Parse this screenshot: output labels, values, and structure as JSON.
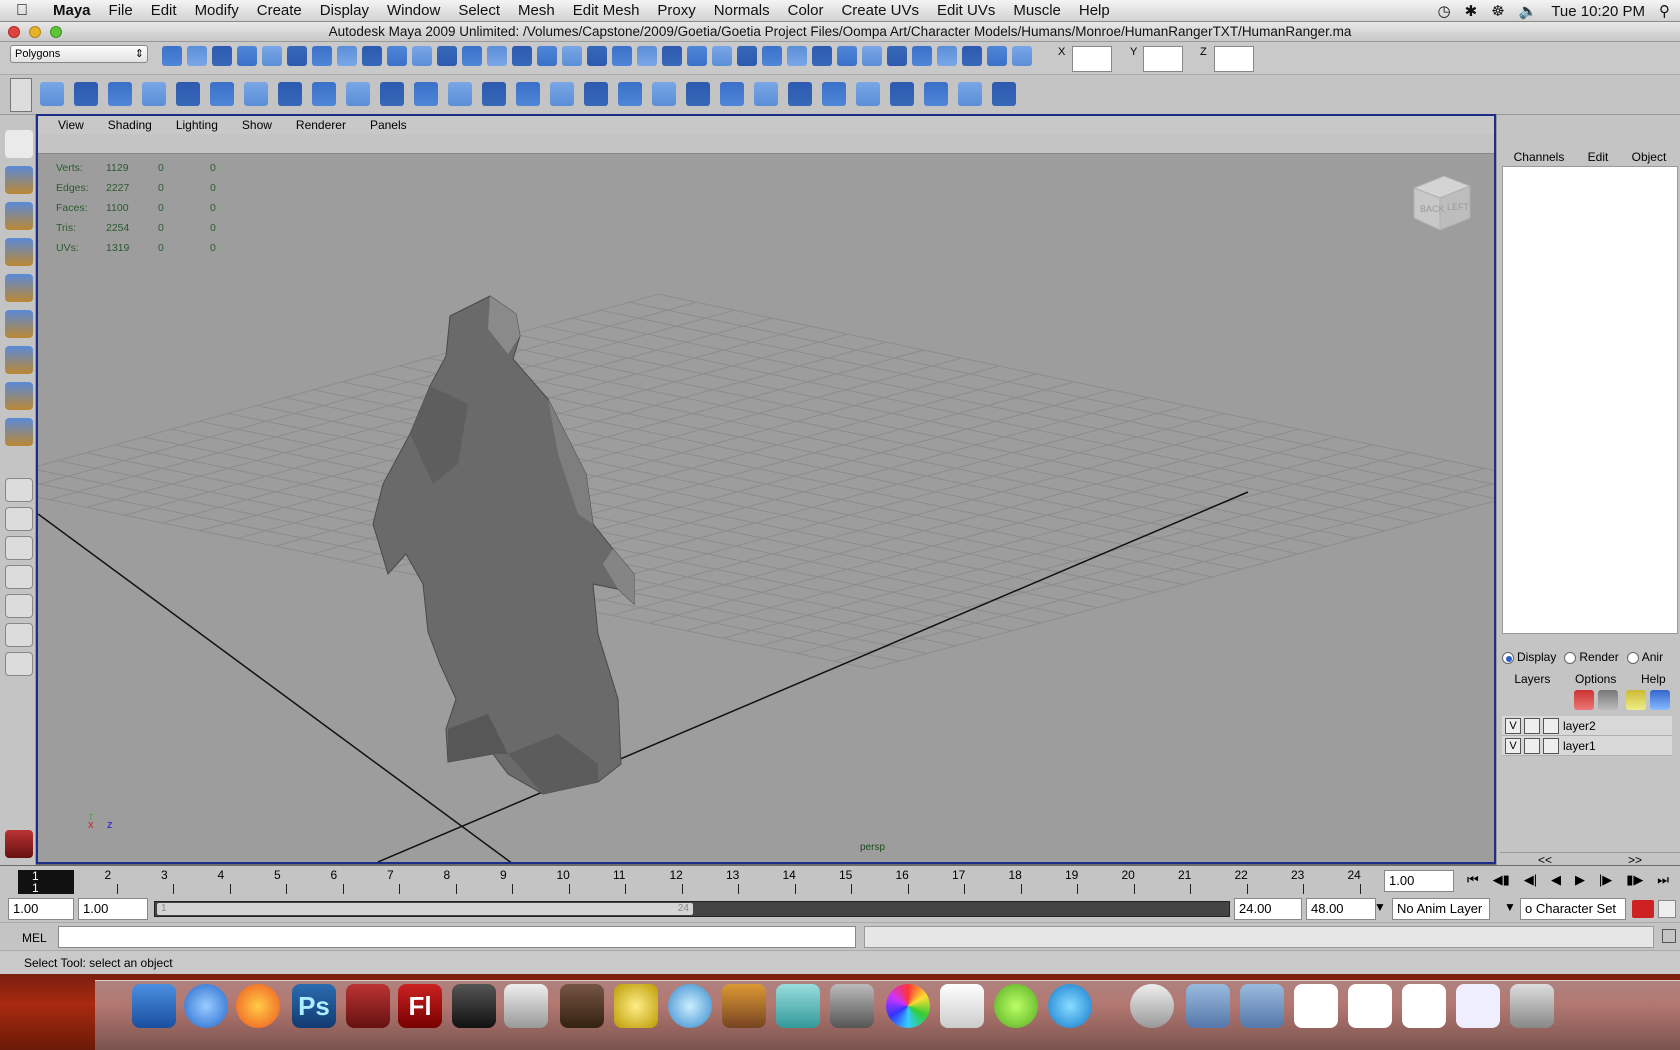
{
  "menubar": {
    "app": "Maya",
    "items": [
      "File",
      "Edit",
      "Modify",
      "Create",
      "Display",
      "Window",
      "Select",
      "Mesh",
      "Edit Mesh",
      "Proxy",
      "Normals",
      "Color",
      "Create UVs",
      "Edit UVs",
      "Muscle",
      "Help"
    ],
    "clock": "Tue 10:20 PM"
  },
  "titlebar": {
    "title": "Autodesk Maya 2009 Unlimited: /Volumes/Capstone/2009/Goetia/Goetia Project Files/Oompa Art/Character Models/Humans/Monroe/HumanRangerTXT/HumanRanger.ma"
  },
  "statusline": {
    "mode": "Polygons",
    "x_label": "X",
    "y_label": "Y",
    "z_label": "Z"
  },
  "panel": {
    "menu": [
      "View",
      "Shading",
      "Lighting",
      "Show",
      "Renderer",
      "Panels"
    ],
    "camera": "persp",
    "viewcube_back": "BACK",
    "viewcube_left": "LEFT"
  },
  "hud": {
    "rows": [
      {
        "label": "Verts:",
        "a": "1129",
        "b": "0",
        "c": "0"
      },
      {
        "label": "Edges:",
        "a": "2227",
        "b": "0",
        "c": "0"
      },
      {
        "label": "Faces:",
        "a": "1100",
        "b": "0",
        "c": "0"
      },
      {
        "label": "Tris:",
        "a": "2254",
        "b": "0",
        "c": "0"
      },
      {
        "label": "UVs:",
        "a": "1319",
        "b": "0",
        "c": "0"
      }
    ]
  },
  "axes": {
    "x": "x",
    "z": "z"
  },
  "channelbox": {
    "tabs": [
      "Channels",
      "Edit",
      "Object"
    ]
  },
  "layers": {
    "radios": [
      {
        "label": "Display",
        "on": true
      },
      {
        "label": "Render",
        "on": false
      },
      {
        "label": "Anir",
        "on": false
      }
    ],
    "menu": [
      "Layers",
      "Options",
      "Help"
    ],
    "items": [
      {
        "vis": "V",
        "name": "layer2"
      },
      {
        "vis": "V",
        "name": "layer1"
      }
    ],
    "nav_prev": "<<",
    "nav_next": ">>"
  },
  "timeline": {
    "ticks": [
      "1",
      "2",
      "3",
      "4",
      "5",
      "6",
      "7",
      "8",
      "9",
      "10",
      "11",
      "12",
      "13",
      "14",
      "15",
      "16",
      "17",
      "18",
      "19",
      "20",
      "21",
      "22",
      "23",
      "24"
    ],
    "current_frame": "1",
    "current_field": "1.00"
  },
  "range": {
    "start": "1.00",
    "playback_start": "1.00",
    "slider_start": "1",
    "slider_end": "24",
    "playback_end": "24.00",
    "end": "48.00",
    "anim_layer": "No Anim Layer",
    "char_set": "o Character Set"
  },
  "cmdline": {
    "label": "MEL"
  },
  "helpline": {
    "text": "Select Tool: select an object"
  }
}
